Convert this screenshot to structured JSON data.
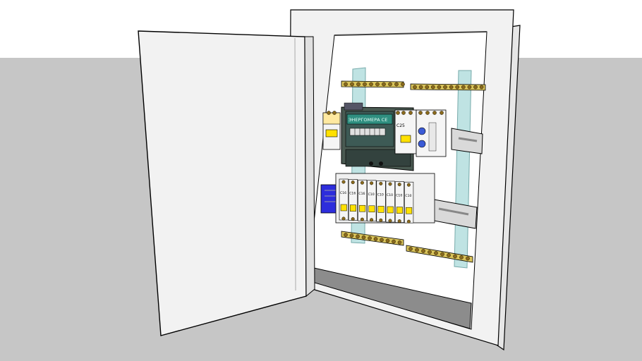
{
  "scene": {
    "subject": "electrical distribution cabinet with open door",
    "colors": {
      "sky": "#ffffff",
      "ground": "#c6c6c6",
      "cabinet": "#f2f2f2",
      "cabinet_edge": "#000000",
      "cabinet_interior": "#ffffff",
      "cabinet_bottom": "#8c8c8c",
      "mounting_rail": "#bfe3e3",
      "din_rail": "#d9d9d9",
      "bus_bar": "#d9c35a",
      "screw": "#8a6a1c",
      "breaker_body": "#f5f5f5",
      "breaker_toggle": "#ffe100",
      "meter_body": "#4a5a52",
      "meter_display": "#2f8f80",
      "relay_blue": "#2d2ddc",
      "dial_blue": "#3b5bd6"
    }
  },
  "meter": {
    "brand": "ЭНЕРГОМЕРА CE"
  },
  "breakers": {
    "main_labels": [
      "C25"
    ],
    "group_labels": [
      "C16",
      "C16",
      "C16",
      "C10",
      "C10",
      "C10",
      "C10",
      "C10"
    ]
  }
}
